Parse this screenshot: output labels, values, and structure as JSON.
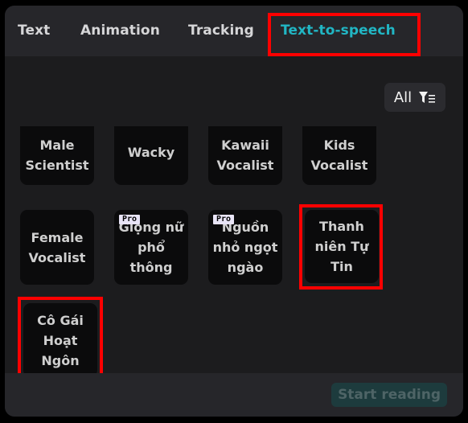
{
  "tabs": [
    {
      "label": "Text",
      "active": false
    },
    {
      "label": "Animation",
      "active": false
    },
    {
      "label": "Tracking",
      "active": false
    },
    {
      "label": "Text-to-speech",
      "active": true
    }
  ],
  "filter": {
    "label": "All",
    "icon": "filter-icon"
  },
  "voices": [
    {
      "label": "Male Scientist",
      "pro": false,
      "highlighted": false
    },
    {
      "label": "Wacky",
      "pro": false,
      "highlighted": false
    },
    {
      "label": "Kawaii Vocalist",
      "pro": false,
      "highlighted": false
    },
    {
      "label": "Kids Vocalist",
      "pro": false,
      "highlighted": false
    },
    {
      "label": "Female Vocalist",
      "pro": false,
      "highlighted": false
    },
    {
      "label": "Giọng nữ phổ thông",
      "pro": true,
      "highlighted": false
    },
    {
      "label": "Nguồn nhỏ ngọt ngào",
      "pro": true,
      "highlighted": false
    },
    {
      "label": "Thanh niên Tự Tin",
      "pro": false,
      "highlighted": true
    },
    {
      "label": "Cô Gái Hoạt Ngôn",
      "pro": false,
      "highlighted": true
    }
  ],
  "pro_badge": "Pro",
  "footer": {
    "start_reading_label": "Start reading"
  },
  "colors": {
    "accent": "#21b6c4",
    "highlight": "#ff0000",
    "panel": "#1c1c1e",
    "header": "#26262a"
  }
}
